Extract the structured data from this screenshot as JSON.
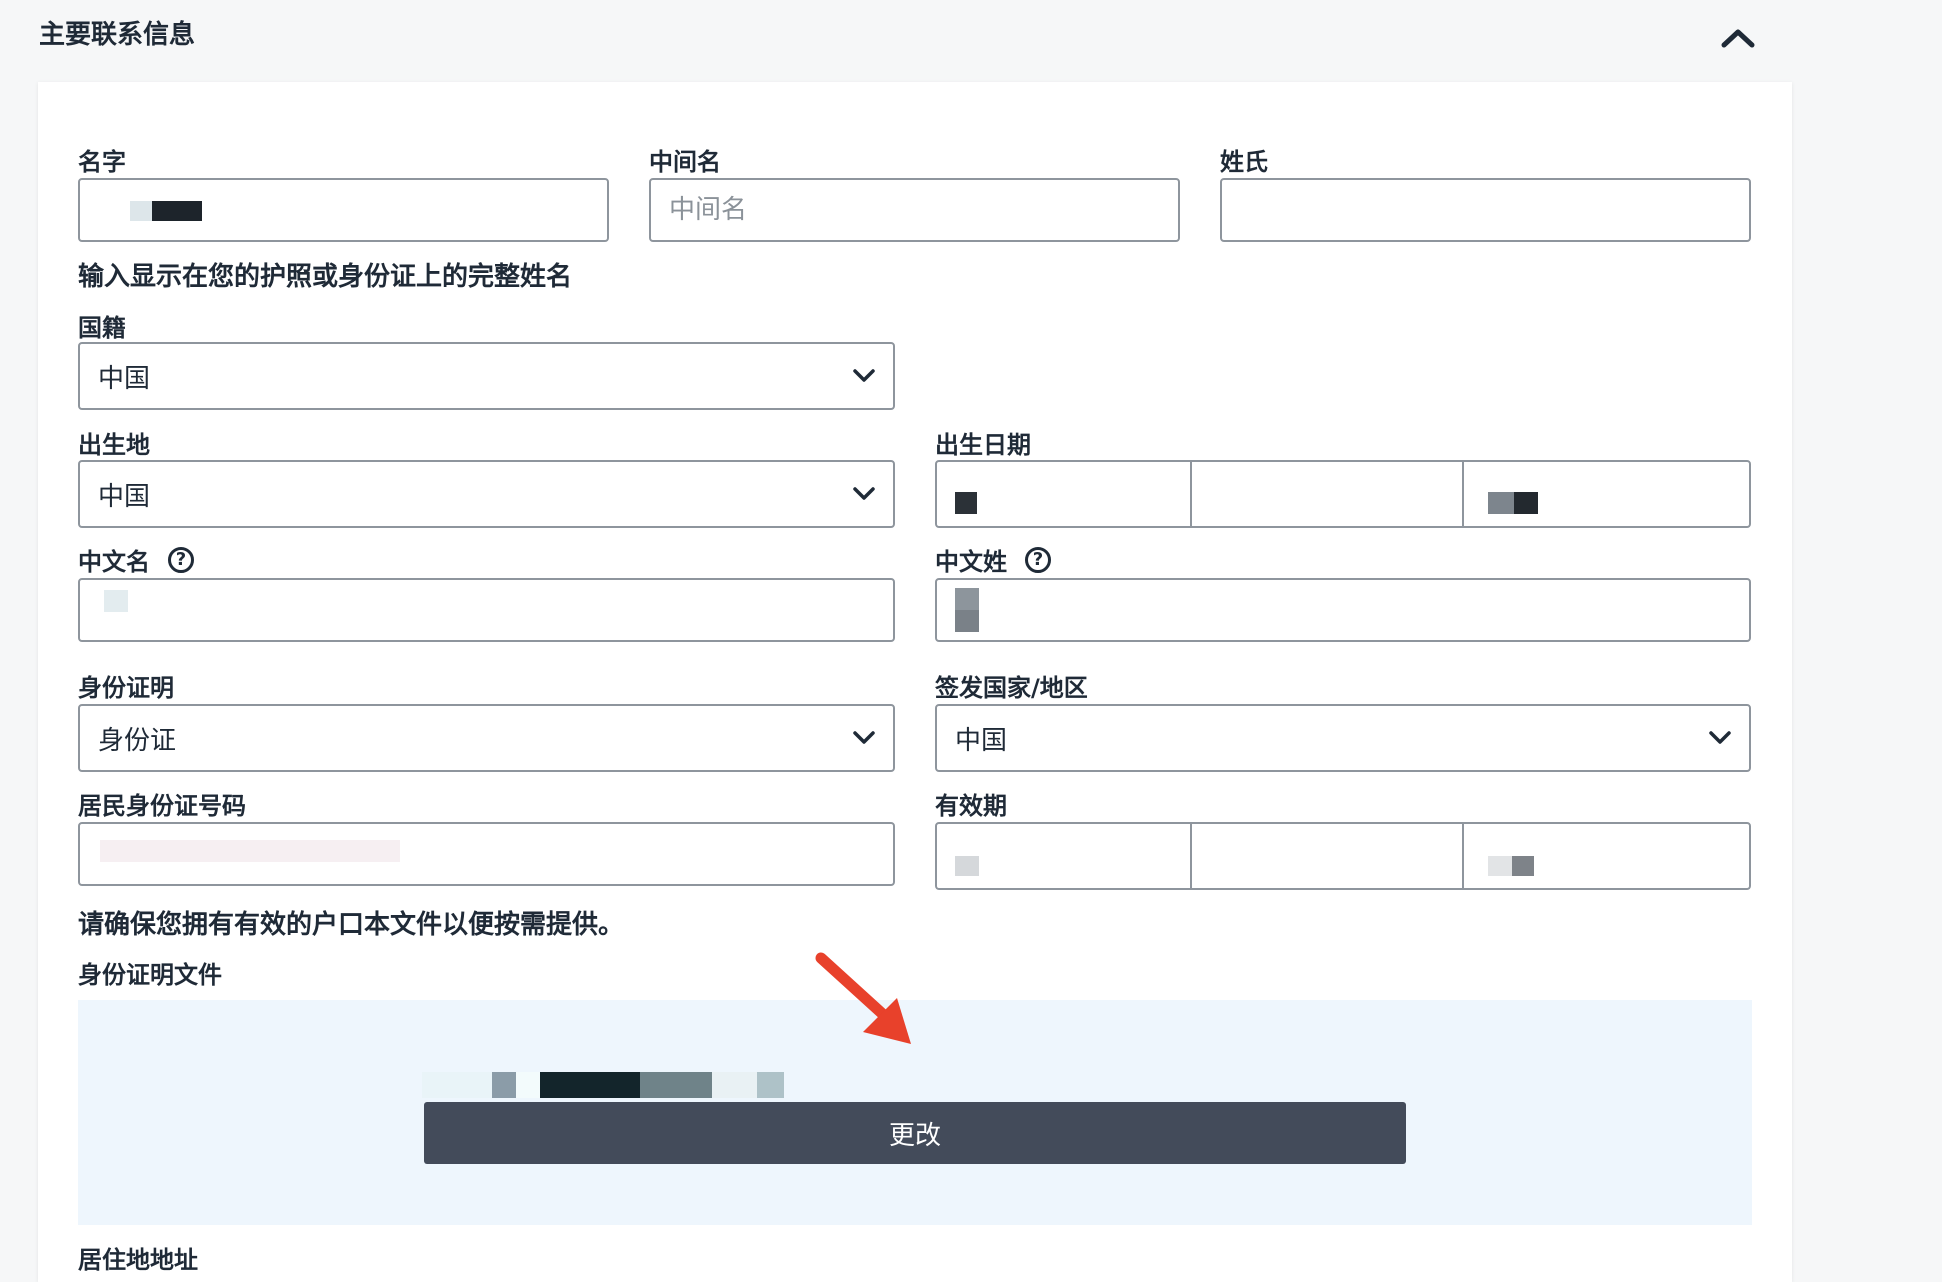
{
  "section": {
    "title": "主要联系信息"
  },
  "fields": {
    "first_name": {
      "label": "名字"
    },
    "middle_name": {
      "label": "中间名",
      "placeholder": "中间名"
    },
    "last_name": {
      "label": "姓氏"
    },
    "name_hint": "输入显示在您的护照或身份证上的完整姓名",
    "nationality": {
      "label": "国籍",
      "value": "中国"
    },
    "birthplace": {
      "label": "出生地",
      "value": "中国"
    },
    "birth_date": {
      "label": "出生日期"
    },
    "chinese_first_name": {
      "label": "中文名"
    },
    "chinese_last_name": {
      "label": "中文姓"
    },
    "id_type": {
      "label": "身份证明",
      "value": "身份证"
    },
    "issuing_country": {
      "label": "签发国家/地区",
      "value": "中国"
    },
    "id_number": {
      "label": "居民身份证号码"
    },
    "expiry_date": {
      "label": "有效期"
    },
    "hukou_hint": "请确保您拥有有效的户口本文件以便按需提供。",
    "id_document": {
      "label": "身份证明文件",
      "change_label": "更改"
    },
    "address": {
      "label": "居住地地址"
    }
  },
  "icons": {
    "collapse": "chevron-up-icon",
    "dropdown": "chevron-down-icon",
    "help": "question-circle-icon",
    "annotation": "red-arrow"
  },
  "colors": {
    "text": "#1f2a37",
    "border": "#8e959d",
    "upload_bg": "#eef6fd",
    "button_bg": "#434b5a",
    "arrow": "#e8412b"
  }
}
